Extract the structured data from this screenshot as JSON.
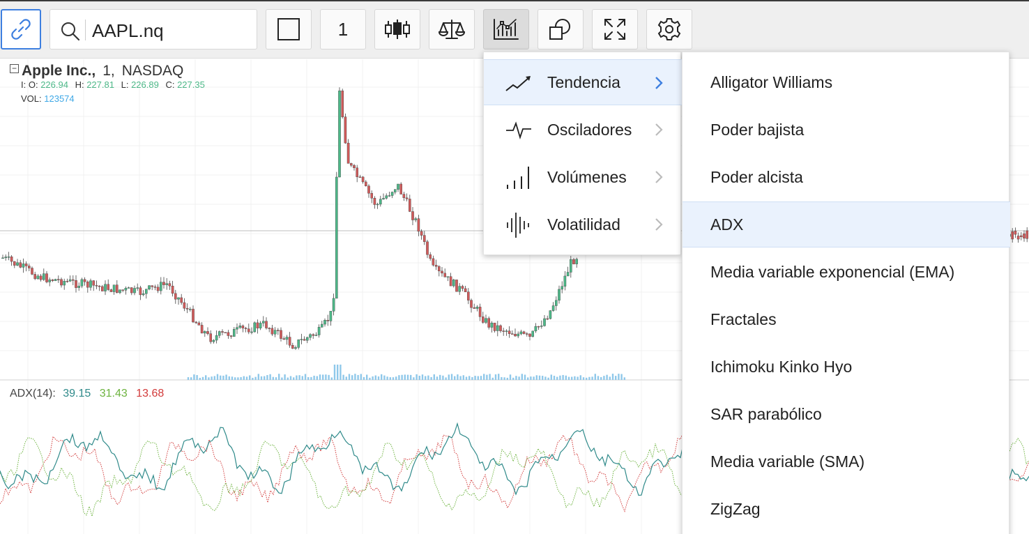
{
  "toolbar": {
    "symbol": "AAPL.nq",
    "interval": "1",
    "icons": [
      "link-icon",
      "search-icon",
      "square-icon",
      "candlestick-icon",
      "scale-icon",
      "indicators-icon",
      "shapes-icon",
      "fullscreen-icon",
      "gear-icon"
    ]
  },
  "legend": {
    "name": "Apple Inc.,",
    "interval": "1,",
    "exchange": "NASDAQ",
    "collapse": "−",
    "open_label": "I: O:",
    "open": "226.94",
    "high_label": "H:",
    "high": "227.81",
    "low_label": "L:",
    "low": "226.89",
    "close_label": "C:",
    "close": "227.35",
    "vol_label": "VOL:",
    "vol": "123574"
  },
  "adx_legend": {
    "label": "ADX(14):",
    "adx": "39.15",
    "plus_di": "31.43",
    "minus_di": "13.68",
    "colors": {
      "adx": "#2f8a8a",
      "plus_di": "#6db33f",
      "minus_di": "#d23a3a"
    }
  },
  "menu_categories": [
    {
      "label": "Tendencia",
      "icon": "trend-up-icon",
      "selected": true
    },
    {
      "label": "Osciladores",
      "icon": "oscillator-icon",
      "selected": false
    },
    {
      "label": "Volúmenes",
      "icon": "volume-bars-icon",
      "selected": false
    },
    {
      "label": "Volatilidad",
      "icon": "volatility-icon",
      "selected": false
    }
  ],
  "menu_indicators": [
    {
      "label": "Alligator Williams",
      "selected": false
    },
    {
      "label": "Poder bajista",
      "selected": false
    },
    {
      "label": "Poder alcista",
      "selected": false
    },
    {
      "label": "ADX",
      "selected": true
    },
    {
      "label": "Media variable exponencial (EMA)",
      "selected": false
    },
    {
      "label": "Fractales",
      "selected": false
    },
    {
      "label": "Ichimoku Kinko Hyo",
      "selected": false
    },
    {
      "label": "SAR parabólico",
      "selected": false
    },
    {
      "label": "Media variable (SMA)",
      "selected": false
    },
    {
      "label": "ZigZag",
      "selected": false
    }
  ],
  "colors": {
    "up": "#4db888",
    "down": "#d05a5a",
    "accent": "#3d7fe0",
    "volume": "#8fc8ea"
  }
}
